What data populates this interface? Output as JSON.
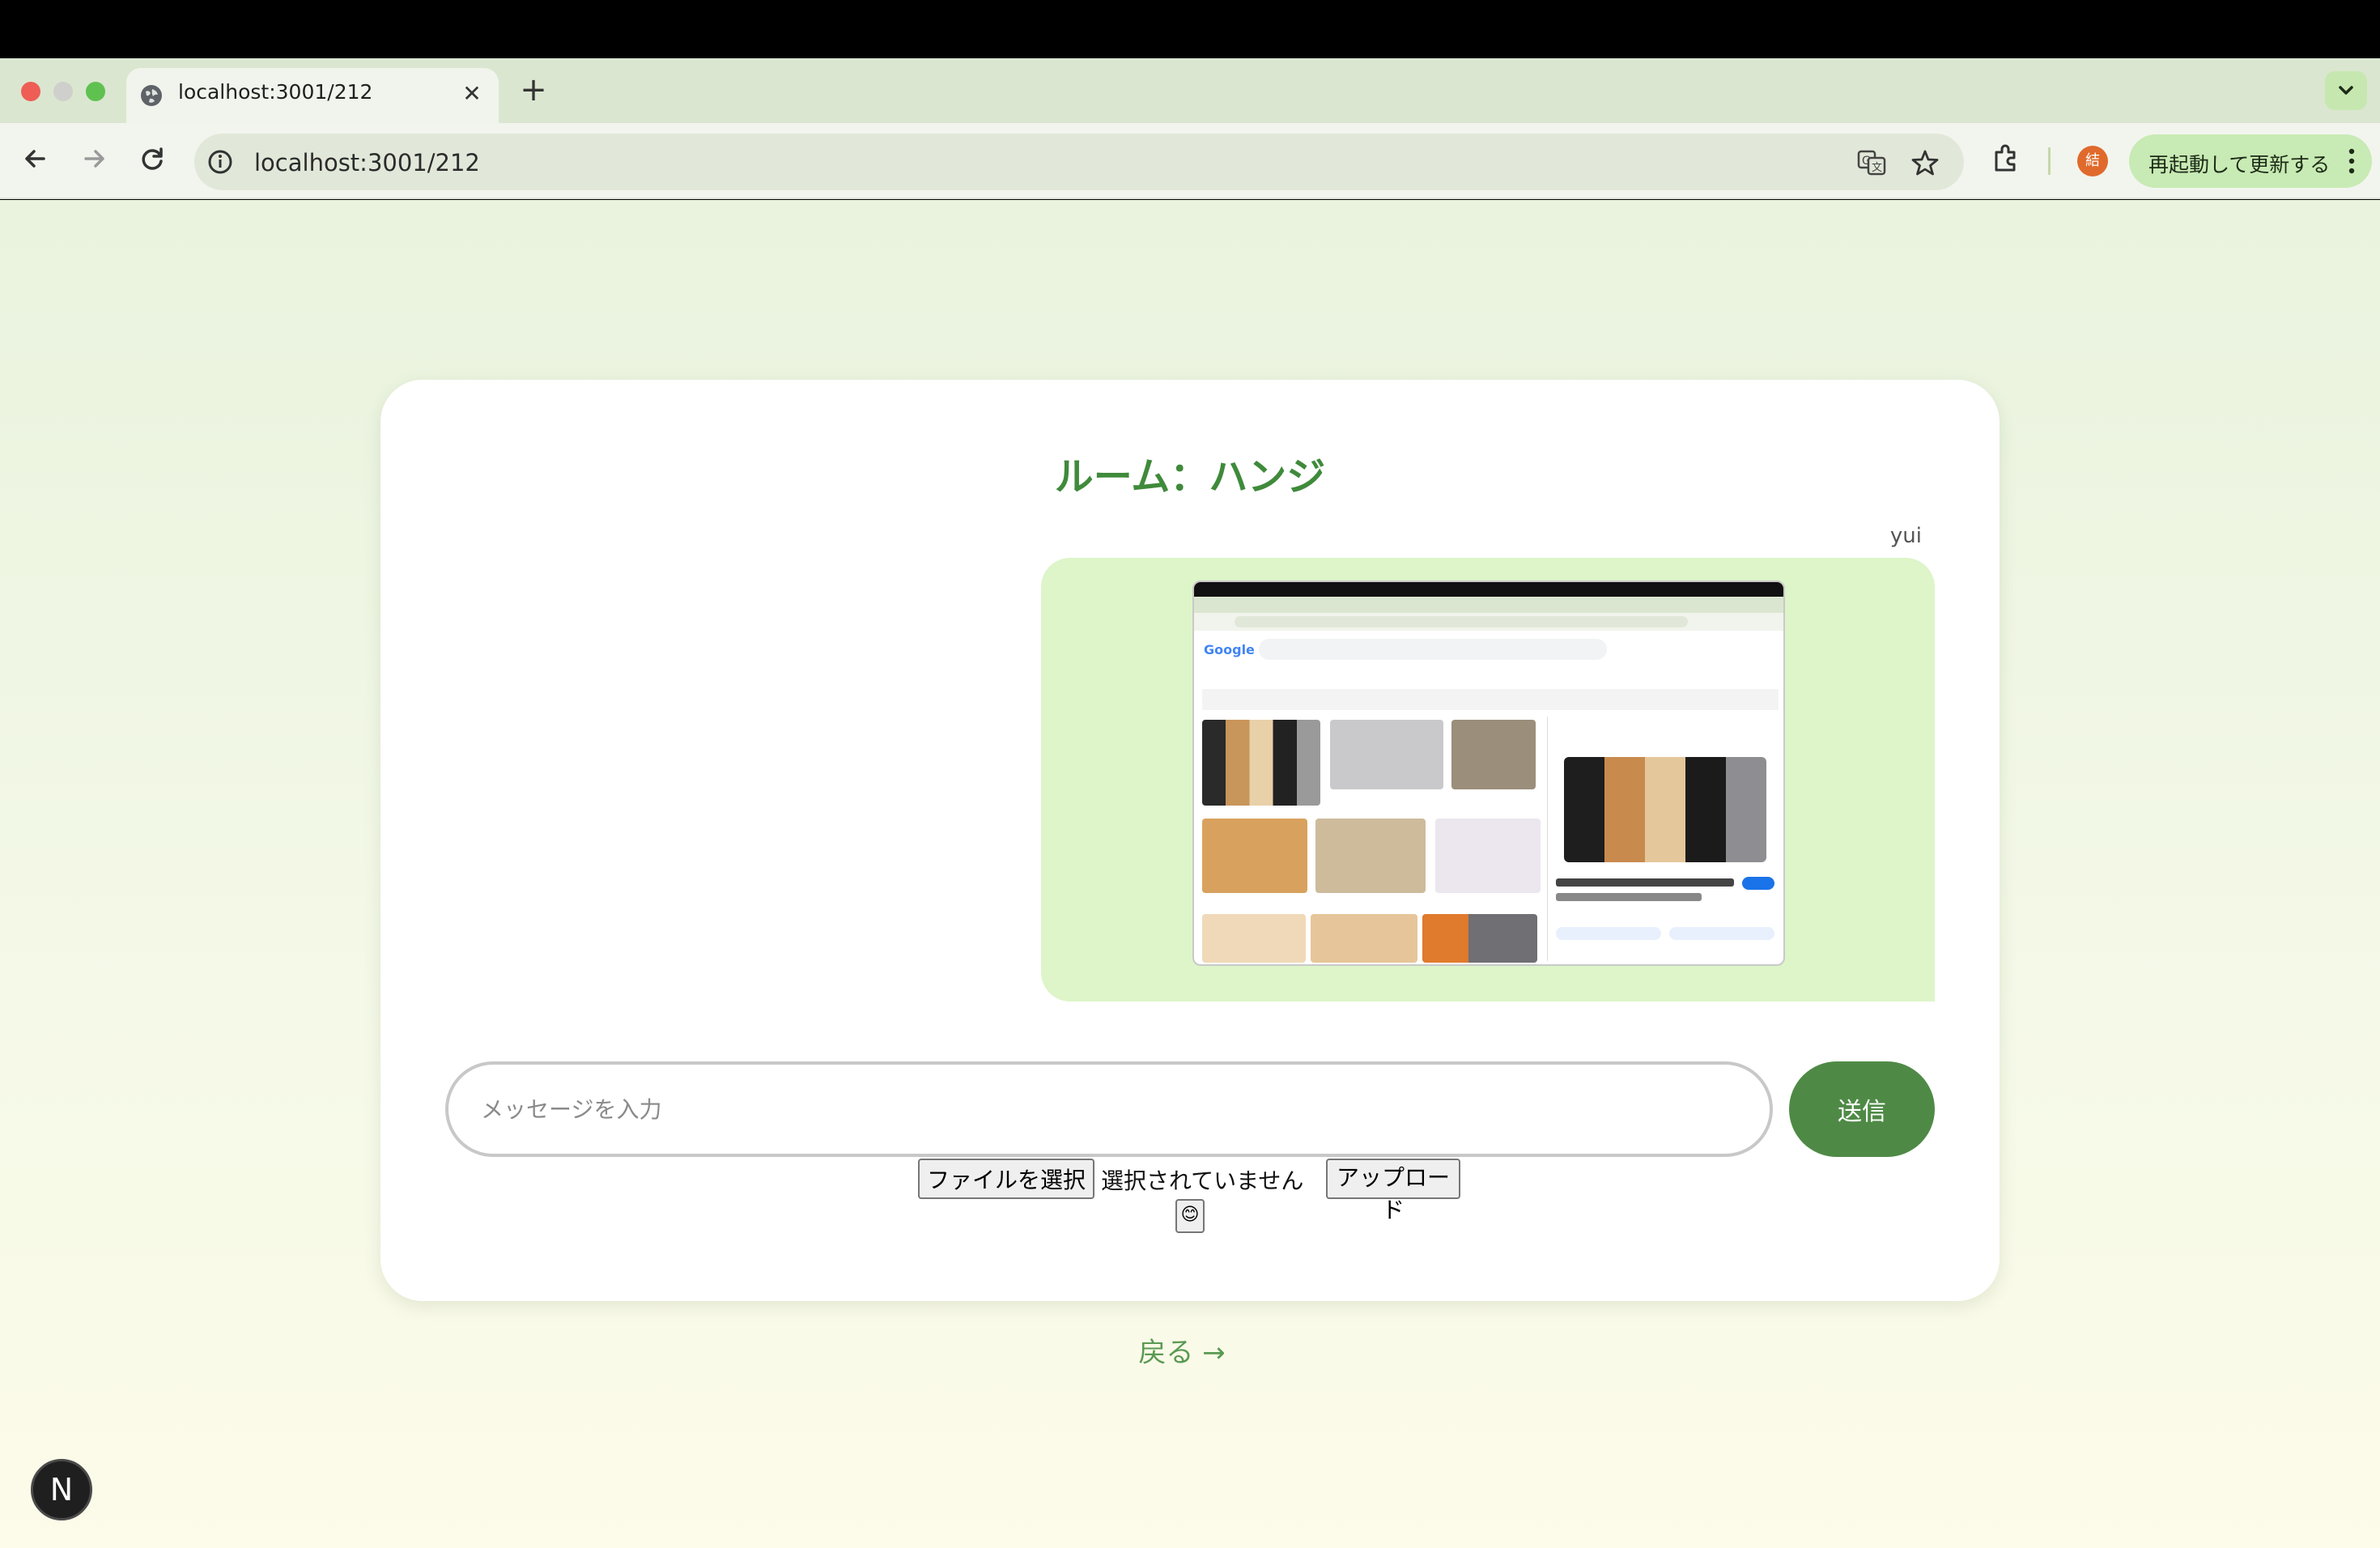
{
  "browser": {
    "tab_title": "localhost:3001/212",
    "tab_close": "✕",
    "new_tab": "+",
    "url": "localhost:3001/212",
    "update_button": "再起動して更新する",
    "profile_initial": "結"
  },
  "room": {
    "title": "ルーム：ハンジ",
    "messages": [
      {
        "sender": "yui",
        "type": "image",
        "image_description": "Google image search results for ねこ showing kittens"
      }
    ]
  },
  "composer": {
    "placeholder": "メッセージを入力",
    "send_label": "送信",
    "file_button": "ファイルを選択",
    "file_status": "選択されていません",
    "upload_button": "アップロード",
    "emoji": "😊"
  },
  "back_link": "戻る →",
  "dev_badge": "N",
  "colors": {
    "accent": "#4e8a45",
    "title": "#3f8a3b",
    "bubble": "#ddf5c8"
  }
}
